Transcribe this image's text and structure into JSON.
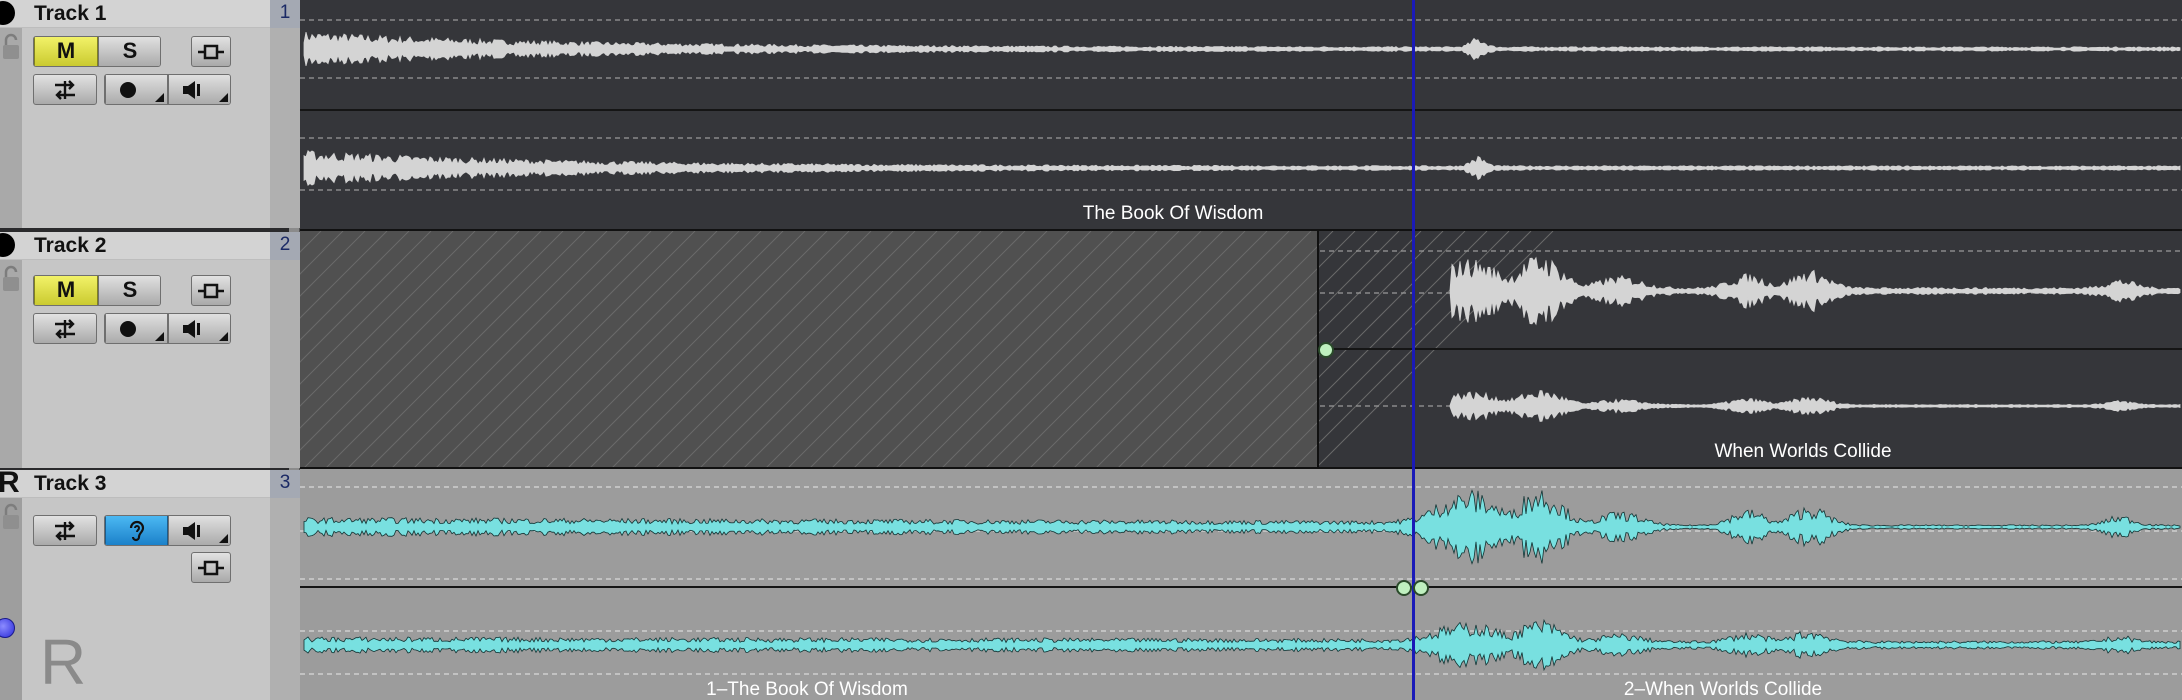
{
  "tracks": [
    {
      "name": "Track 1",
      "number": "1",
      "mute": "M",
      "solo": "S"
    },
    {
      "name": "Track 2",
      "number": "2",
      "mute": "M",
      "solo": "S"
    },
    {
      "name": "Track 3",
      "number": "3",
      "mode": "R",
      "overlay_letter": "R"
    }
  ],
  "clips": {
    "track1": "The Book Of Wisdom",
    "track2": "When Worlds Collide",
    "track3_a": "1–The Book Of Wisdom",
    "track3_b": "2–When Worlds Collide"
  },
  "colors": {
    "mute": "#e6e64a",
    "monitor": "#2a9ce0",
    "waveform_gray": "#d0d0d0",
    "waveform_cyan": "#7ee8e8",
    "playhead": "#1a1ab8",
    "handle": "#bff0bf"
  },
  "icons": [
    "lock-icon",
    "routing-icon",
    "record-icon",
    "speaker-icon",
    "ear-icon",
    "fx-insert-icon",
    "playhead-icon"
  ]
}
